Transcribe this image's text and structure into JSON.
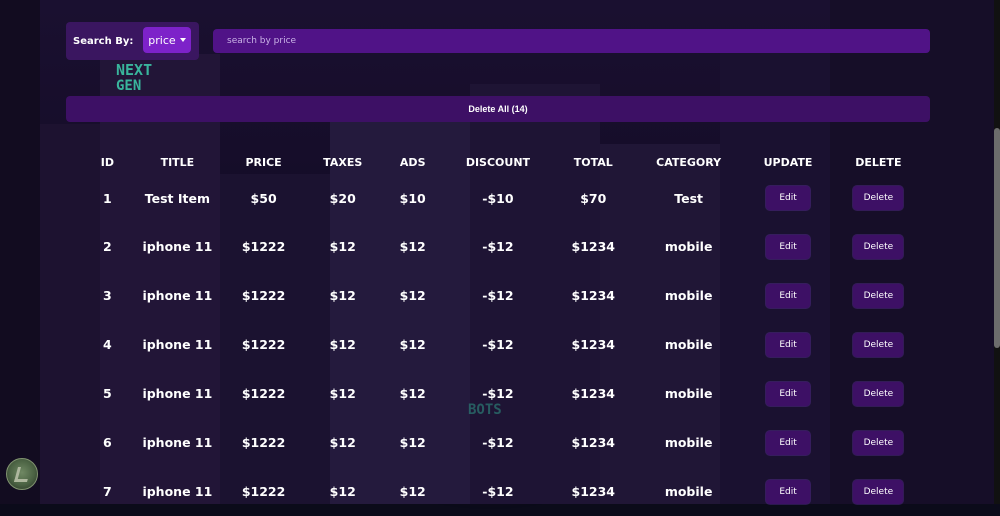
{
  "search": {
    "by_label": "Search By:",
    "mode": "price",
    "placeholder": "search by price"
  },
  "delete_all_label": "Delete All (14)",
  "table": {
    "headers": [
      "ID",
      "TITLE",
      "PRICE",
      "TAXES",
      "ADS",
      "DISCOUNT",
      "TOTAL",
      "CATEGORY",
      "UPDATE",
      "DELETE"
    ],
    "edit_label": "Edit",
    "delete_label": "Delete",
    "rows": [
      {
        "id": "1",
        "title": "Test Item",
        "price": "$50",
        "taxes": "$20",
        "ads": "$10",
        "discount": "-$10",
        "total": "$70",
        "category": "Test"
      },
      {
        "id": "2",
        "title": "iphone 11",
        "price": "$1222",
        "taxes": "$12",
        "ads": "$12",
        "discount": "-$12",
        "total": "$1234",
        "category": "mobile"
      },
      {
        "id": "3",
        "title": "iphone 11",
        "price": "$1222",
        "taxes": "$12",
        "ads": "$12",
        "discount": "-$12",
        "total": "$1234",
        "category": "mobile"
      },
      {
        "id": "4",
        "title": "iphone 11",
        "price": "$1222",
        "taxes": "$12",
        "ads": "$12",
        "discount": "-$12",
        "total": "$1234",
        "category": "mobile"
      },
      {
        "id": "5",
        "title": "iphone 11",
        "price": "$1222",
        "taxes": "$12",
        "ads": "$12",
        "discount": "-$12",
        "total": "$1234",
        "category": "mobile"
      },
      {
        "id": "6",
        "title": "iphone 11",
        "price": "$1222",
        "taxes": "$12",
        "ads": "$12",
        "discount": "-$12",
        "total": "$1234",
        "category": "mobile"
      },
      {
        "id": "7",
        "title": "iphone 11",
        "price": "$1222",
        "taxes": "$12",
        "ads": "$12",
        "discount": "-$12",
        "total": "$1234",
        "category": "mobile"
      }
    ]
  },
  "background": {
    "signs": [
      "NEXT",
      "GEN",
      "BOTS"
    ]
  },
  "colors": {
    "accent": "#7d22c9",
    "panel": "#3d1065",
    "input": "#5a1496"
  }
}
